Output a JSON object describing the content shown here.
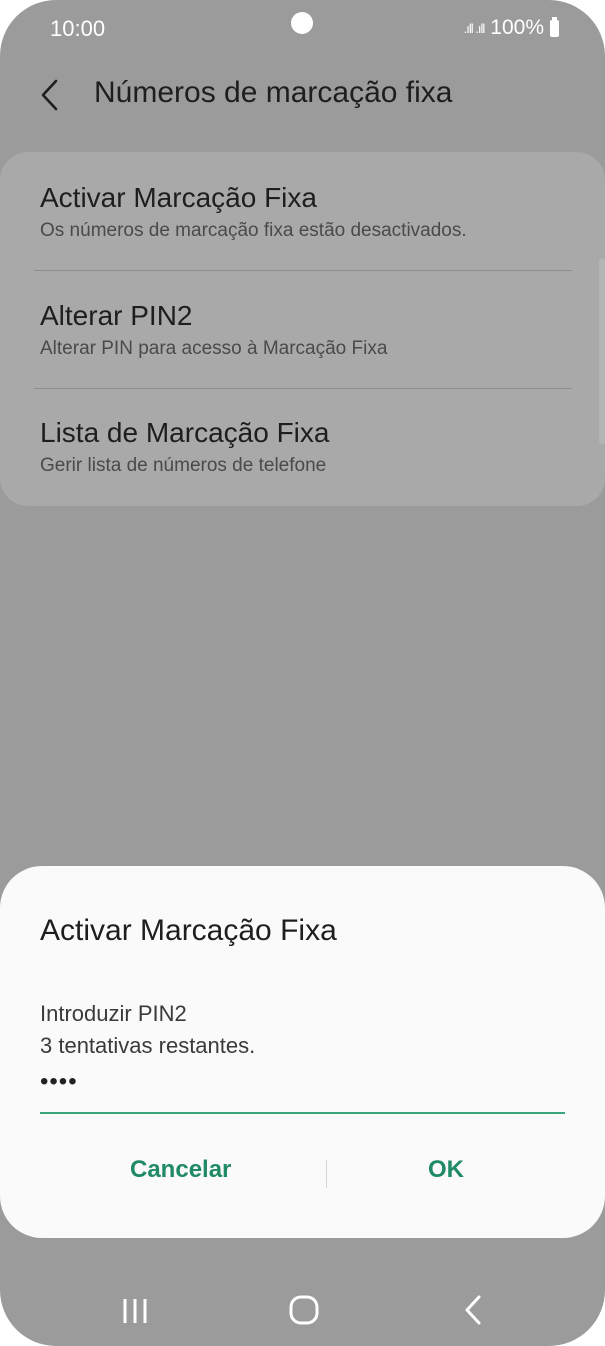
{
  "status_bar": {
    "time": "10:00",
    "signal": ".ıll .ıll",
    "battery": "100%"
  },
  "header": {
    "title": "Números de marcação fixa"
  },
  "menu": {
    "items": [
      {
        "title": "Activar Marcação Fixa",
        "subtitle": "Os números de marcação fixa estão desactivados."
      },
      {
        "title": "Alterar PIN2",
        "subtitle": "Alterar PIN para acesso à Marcação Fixa"
      },
      {
        "title": "Lista de Marcação Fixa",
        "subtitle": "Gerir lista de números de telefone"
      }
    ]
  },
  "dialog": {
    "title": "Activar Marcação Fixa",
    "message_line1": "Introduzir PIN2",
    "message_line2": "3 tentativas restantes.",
    "pin_value": "••••",
    "cancel_label": "Cancelar",
    "ok_label": "OK"
  },
  "colors": {
    "accent": "#1f8a63",
    "underline": "#3aa47a",
    "scrim": "#9b9b9b"
  },
  "icons": {
    "back": "chevron-left-icon",
    "nav_recent": "recent-apps-icon",
    "nav_home": "home-icon",
    "nav_back": "nav-back-icon"
  }
}
